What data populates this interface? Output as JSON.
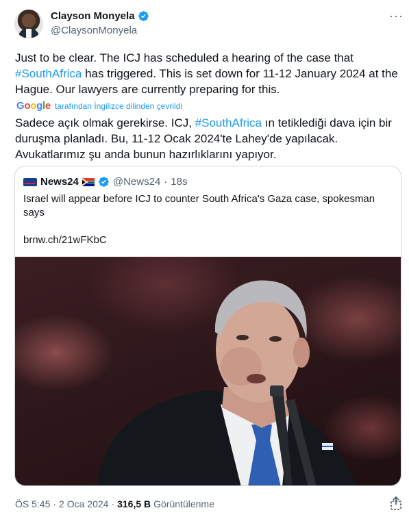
{
  "author": {
    "name": "Clayson Monyela",
    "handle": "@ClaysonMonyela"
  },
  "tweet": {
    "text_part1": "Just to be clear. The ICJ has scheduled a hearing of the case that ",
    "hashtag": "#SouthAfrica",
    "text_part2": " has triggered. This is set down for 11-12 January 2024 at the Hague. Our lawyers are currently preparing for this.",
    "translation_label": "tarafından İngilizce dilinden çevrildi",
    "translated_part1": "Sadece açık olmak gerekirse. ICJ, ",
    "translated_hashtag": "#SouthAfrica",
    "translated_part2": " ın tetiklediği dava için bir duruşma planladı. Bu, 11-12 Ocak 2024'te Lahey'de yapılacak. Avukatlarımız şu anda bunun hazırlıklarını yapıyor."
  },
  "translator_brand": "Google",
  "quoted": {
    "name": "News24",
    "handle": "@News24",
    "separator": "·",
    "time": "18s",
    "text": "Israel will appear before ICJ to counter South Africa's Gaza case, spokesman says",
    "link": "brnw.ch/21wFKbC"
  },
  "footer": {
    "time": "ÖS 5:45",
    "sep1": "·",
    "date": "2 Oca 2024",
    "sep2": "·",
    "views_count": "316,5 B",
    "views_label": "Görüntülenme"
  },
  "colors": {
    "accent": "#1d9bf0",
    "text": "#0f1419",
    "muted": "#536471"
  },
  "icons": {
    "verified": "verified-badge-icon",
    "more": "more-options-icon",
    "share": "share-icon"
  }
}
